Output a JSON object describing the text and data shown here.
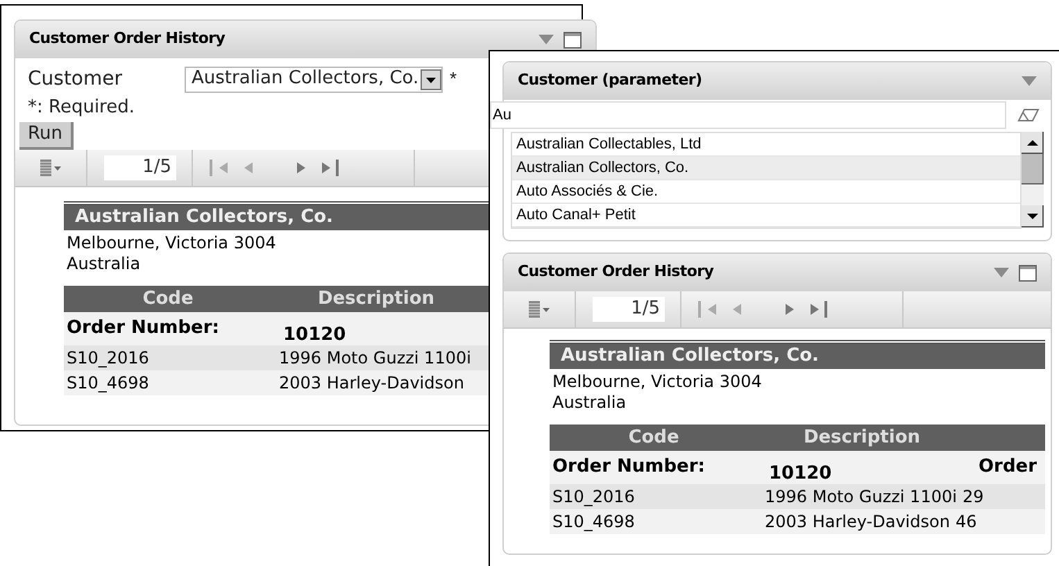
{
  "back_window": {
    "panel_title": "Customer Order History",
    "parameter": {
      "label": "Customer",
      "value": "Australian Collectors, Co.",
      "required_mark": "*"
    },
    "note": "*: Required.",
    "run_button": "Run",
    "toolbar": {
      "page": "1/5"
    },
    "report": {
      "customer_name": "Australian Collectors, Co.",
      "address_lines": [
        "Melbourne, Victoria 3004",
        "Australia"
      ],
      "columns": [
        "Code",
        "Description"
      ],
      "order_label": "Order Number:",
      "order_number": "10120",
      "rows": [
        {
          "code": "S10_2016",
          "description": "1996 Moto Guzzi 1100i"
        },
        {
          "code": "S10_4698",
          "description": "2003 Harley-Davidson"
        }
      ]
    }
  },
  "front_window": {
    "parameter_panel": {
      "title": "Customer (parameter)",
      "search_value": "Au",
      "options": [
        {
          "label": "Australian Collectables, Ltd",
          "selected": false
        },
        {
          "label": "Australian Collectors, Co.",
          "selected": true
        },
        {
          "label": "Auto Associés & Cie.",
          "selected": false
        },
        {
          "label": "Auto Canal+ Petit",
          "selected": false
        }
      ]
    },
    "report_panel": {
      "title": "Customer Order History",
      "toolbar": {
        "page": "1/5"
      },
      "report": {
        "customer_name": "Australian Collectors, Co.",
        "address_lines": [
          "Melbourne, Victoria 3004",
          "Australia"
        ],
        "columns": [
          "Code",
          "Description"
        ],
        "order_label": "Order Number:",
        "order_number": "10120",
        "order_extra": "Order",
        "rows": [
          {
            "code": "S10_2016",
            "description": "1996 Moto Guzzi 1100i",
            "quantity": "29"
          },
          {
            "code": "S10_4698",
            "description": "2003 Harley-Davidson",
            "quantity": "46"
          }
        ]
      }
    }
  }
}
